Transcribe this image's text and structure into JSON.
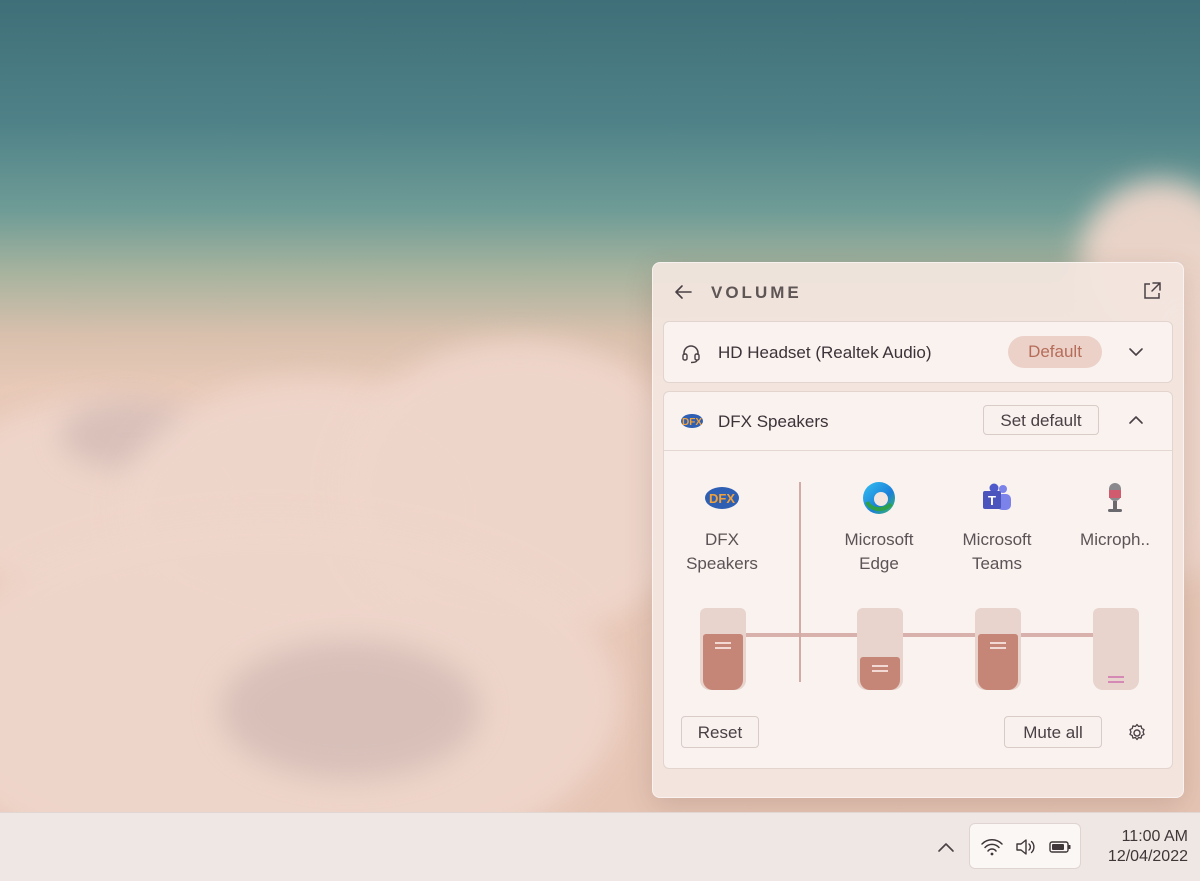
{
  "panel": {
    "title": "VOLUME"
  },
  "devices": [
    {
      "name": "HD Headset (Realtek Audio)",
      "badge": "Default",
      "icon": "headset-icon",
      "expanded": false
    },
    {
      "name": "DFX Speakers",
      "action": "Set default",
      "icon": "dfx-logo-icon",
      "expanded": true
    }
  ],
  "mixer": {
    "channels": [
      {
        "line1": "DFX",
        "line2": "Speakers",
        "icon": "dfx-logo-icon",
        "level": 0.68
      },
      {
        "line1": "Microsoft",
        "line2": "Edge",
        "icon": "edge-icon",
        "level": 0.4
      },
      {
        "line1": "Microsoft",
        "line2": "Teams",
        "icon": "teams-icon",
        "level": 0.68
      },
      {
        "line1": "Microph..",
        "line2": "",
        "icon": "microphone-icon",
        "level": 0.0
      }
    ],
    "reset_label": "Reset",
    "mute_all_label": "Mute all"
  },
  "taskbar": {
    "time": "11:00 AM",
    "date": "12/04/2022"
  },
  "colors": {
    "accent": "#c58677",
    "accent_light": "#ecd1c8",
    "panel_bg": "#f3e6e0"
  }
}
